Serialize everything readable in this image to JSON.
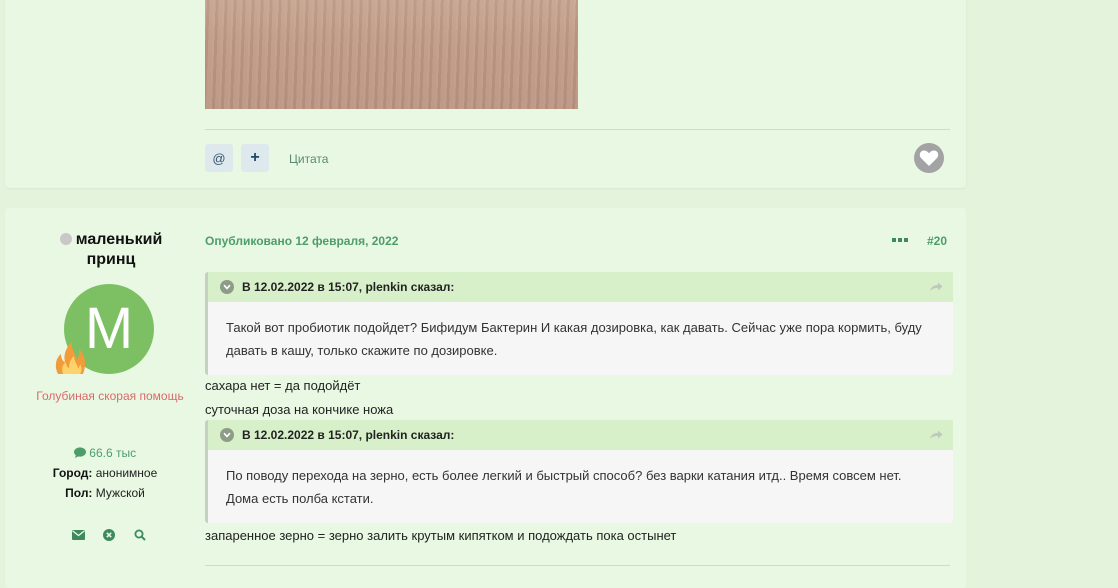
{
  "actions": {
    "mention_label": "@",
    "plus_label": "+",
    "quote_label": "Цитата"
  },
  "author": {
    "name": "маленький принц",
    "avatar_letter": "M",
    "group": "Голубиная скорая помощь",
    "posts_count": "66.6 тыс",
    "city_label": "Город:",
    "city_value": "анонимное",
    "gender_label": "Пол:",
    "gender_value": "Мужской"
  },
  "post": {
    "published_prefix": "Опубликовано",
    "date": "12 февраля, 2022",
    "number": "#20",
    "more_icon": "⋯"
  },
  "quote1": {
    "header": "В 12.02.2022 в 15:07, plenkin сказал:",
    "body": "Такой вот пробиотик подойдет? Бифидум Бактерин И какая дозировка, как давать. Сейчас уже пора кормить, буду давать в кашу, только скажите по дозировке."
  },
  "reply1_line1": "сахара нет = да подойдёт",
  "reply1_line2": "суточная доза на кончике ножа",
  "quote2": {
    "header": "В 12.02.2022 в 15:07, plenkin сказал:",
    "body": "По поводу перехода на зерно, есть более легкий и быстрый способ? без варки катания итд.. Время совсем нет. Дома есть полба кстати."
  },
  "reply2": "запаренное зерно = зерно залить крутым кипятком и подождать пока остынет",
  "colors": {
    "page_bg": "#e4f3dc",
    "post_bg": "#e9f8e3",
    "accent_green": "#4d9d6b",
    "group_red": "#d96a6a",
    "quote_head_bg": "#d7f0c9"
  }
}
